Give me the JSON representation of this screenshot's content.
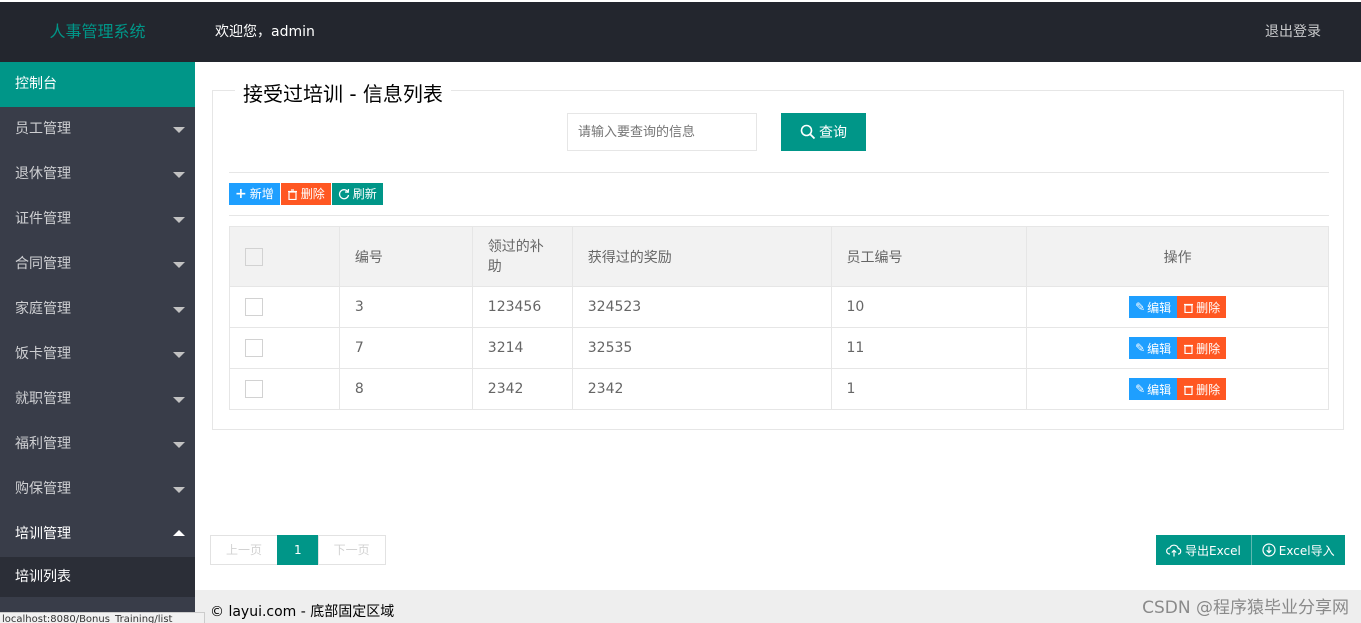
{
  "header": {
    "logo": "人事管理系统",
    "welcome": "欢迎您，admin",
    "logout": "退出登录"
  },
  "sidebar": {
    "dashboard": "控制台",
    "items": [
      {
        "label": "员工管理"
      },
      {
        "label": "退休管理"
      },
      {
        "label": "证件管理"
      },
      {
        "label": "合同管理"
      },
      {
        "label": "家庭管理"
      },
      {
        "label": "饭卡管理"
      },
      {
        "label": "就职管理"
      },
      {
        "label": "福利管理"
      },
      {
        "label": "购保管理"
      }
    ],
    "open_item": "培训管理",
    "sub_item": "培训列表"
  },
  "main": {
    "title": "接受过培训 - 信息列表",
    "search": {
      "placeholder": "请输入要查询的信息",
      "button": "查询"
    },
    "toolbar": {
      "add": "新增",
      "delete": "删除",
      "refresh": "刷新"
    },
    "table": {
      "headers": [
        "编号",
        "领过的补助",
        "获得过的奖励",
        "员工编号",
        "操作"
      ],
      "rows": [
        {
          "id": "3",
          "subsidy": "123456",
          "award": "324523",
          "emp": "10"
        },
        {
          "id": "7",
          "subsidy": "3214",
          "award": "32535",
          "emp": "11"
        },
        {
          "id": "8",
          "subsidy": "2342",
          "award": "2342",
          "emp": "1"
        }
      ],
      "edit": "编辑",
      "del": "删除"
    },
    "pager": {
      "prev": "上一页",
      "current": "1",
      "next": "下一页"
    },
    "export": "导出Excel",
    "import": "Excel导入"
  },
  "footer": {
    "text": "© layui.com - 底部固定区域"
  },
  "watermark": "CSDN @程序猿毕业分享网",
  "status_url": "localhost:8080/Bonus_Training/list"
}
